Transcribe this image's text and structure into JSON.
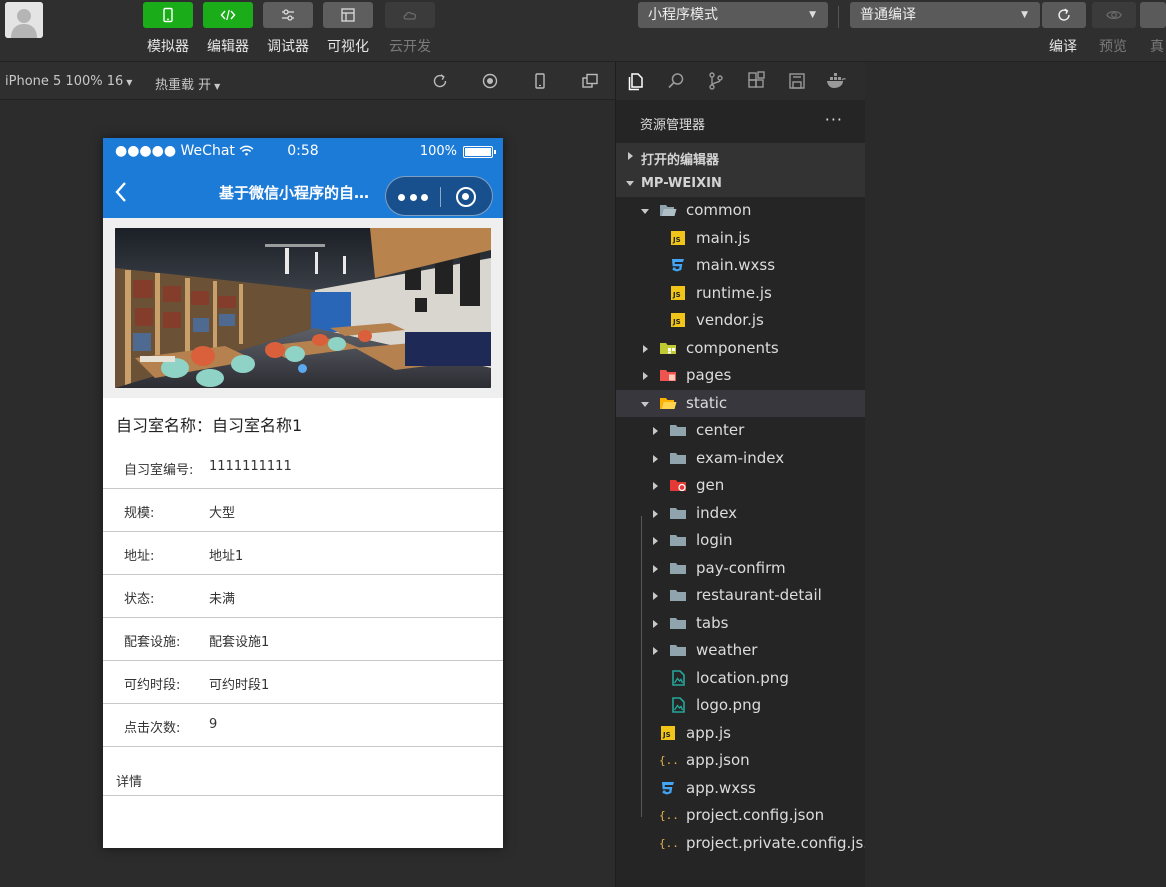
{
  "toolbar": {
    "buttons": [
      {
        "label": "模拟器",
        "icon": "phone-icon"
      },
      {
        "label": "编辑器",
        "icon": "code-icon"
      },
      {
        "label": "调试器",
        "icon": "debug-icon"
      },
      {
        "label": "可视化",
        "icon": "layout-icon"
      },
      {
        "label": "云开发",
        "icon": "cloud-icon"
      }
    ],
    "mode_select": "小程序模式",
    "compile_select": "普通编译",
    "right_labels": [
      "编译",
      "预览",
      "真"
    ]
  },
  "simbar": {
    "device": "iPhone 5 100% 16",
    "hot_reload": "热重载 开"
  },
  "phone": {
    "status": {
      "carrier": "●●●●● WeChat",
      "time": "0:58",
      "battery": "100%"
    },
    "nav_title": "基于微信小程序的自习室预约系统",
    "room_name_label": "自习室名称：",
    "room_name": "自习室名称1",
    "rows": [
      {
        "k": "自习室编号:",
        "v": "1111111111"
      },
      {
        "k": "规模:",
        "v": "大型"
      },
      {
        "k": "地址:",
        "v": "地址1"
      },
      {
        "k": "状态:",
        "v": "未满"
      },
      {
        "k": "配套设施:",
        "v": "配套设施1"
      },
      {
        "k": "可约时段:",
        "v": "可约时段1"
      },
      {
        "k": "点击次数:",
        "v": "9"
      }
    ],
    "detail_label": "详情"
  },
  "explorer": {
    "title": "资源管理器",
    "more": "···",
    "open_editors": "打开的编辑器",
    "project": "MP-WEIXIN",
    "tree": [
      {
        "name": "common",
        "depth": 1,
        "type": "folder-open",
        "arrow": "down"
      },
      {
        "name": "main.js",
        "depth": 2,
        "type": "js"
      },
      {
        "name": "main.wxss",
        "depth": 2,
        "type": "css"
      },
      {
        "name": "runtime.js",
        "depth": 2,
        "type": "js"
      },
      {
        "name": "vendor.js",
        "depth": 2,
        "type": "js"
      },
      {
        "name": "components",
        "depth": 1,
        "type": "folder-components",
        "arrow": "right"
      },
      {
        "name": "pages",
        "depth": 1,
        "type": "folder-pages",
        "arrow": "right"
      },
      {
        "name": "static",
        "depth": 1,
        "type": "folder-static",
        "arrow": "down",
        "selected": true
      },
      {
        "name": "center",
        "depth": 2,
        "type": "folder",
        "arrow": "right"
      },
      {
        "name": "exam-index",
        "depth": 2,
        "type": "folder",
        "arrow": "right"
      },
      {
        "name": "gen",
        "depth": 2,
        "type": "folder-gen",
        "arrow": "right"
      },
      {
        "name": "index",
        "depth": 2,
        "type": "folder",
        "arrow": "right"
      },
      {
        "name": "login",
        "depth": 2,
        "type": "folder",
        "arrow": "right"
      },
      {
        "name": "pay-confirm",
        "depth": 2,
        "type": "folder",
        "arrow": "right"
      },
      {
        "name": "restaurant-detail",
        "depth": 2,
        "type": "folder",
        "arrow": "right"
      },
      {
        "name": "tabs",
        "depth": 2,
        "type": "folder",
        "arrow": "right"
      },
      {
        "name": "weather",
        "depth": 2,
        "type": "folder",
        "arrow": "right"
      },
      {
        "name": "location.png",
        "depth": 2,
        "type": "image"
      },
      {
        "name": "logo.png",
        "depth": 2,
        "type": "image"
      },
      {
        "name": "app.js",
        "depth": 1,
        "type": "js"
      },
      {
        "name": "app.json",
        "depth": 1,
        "type": "json"
      },
      {
        "name": "app.wxss",
        "depth": 1,
        "type": "css"
      },
      {
        "name": "project.config.json",
        "depth": 1,
        "type": "json"
      },
      {
        "name": "project.private.config.js...",
        "depth": 1,
        "type": "json"
      }
    ]
  },
  "colors": {
    "accent_green": "#1aad19",
    "nav_blue": "#1d7bd8",
    "js_yellow": "#f0c419",
    "css_blue": "#42a5f5",
    "json_yellow": "#e8b54a"
  }
}
